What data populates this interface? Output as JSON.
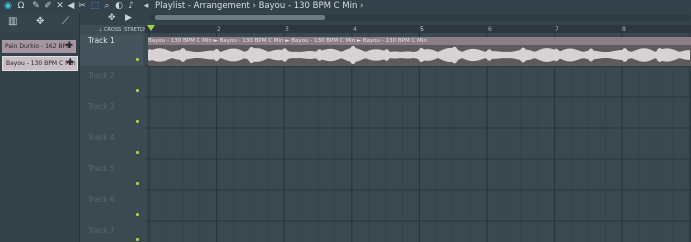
{
  "titlebar": {
    "title": "Playlist - Arrangement › Bayou - 130 BPM C Min ›"
  },
  "patterns": [
    {
      "label": "Pain Durkio - 162 BPM",
      "plus": "✚"
    },
    {
      "label": "Bayou - 130 BPM C Min",
      "plus": "✚"
    }
  ],
  "toolbar": {
    "snap_label": "⊥ CROSS",
    "stretch_label": "STRETCH"
  },
  "ruler": [
    "2",
    "3",
    "4",
    "5",
    "6",
    "7",
    "8"
  ],
  "tracks": [
    {
      "name": "Track 1"
    },
    {
      "name": "Track 2"
    },
    {
      "name": "Track 3"
    },
    {
      "name": "Track 4"
    },
    {
      "name": "Track 5"
    },
    {
      "name": "Track 6"
    },
    {
      "name": "Track 7"
    }
  ],
  "clip": {
    "label": "Bayou - 130 BPM C Min ► Bayou - 130 BPM C Min ► Bayou - 130 BPM C Min ► Bayou - 130 BPM C Min"
  },
  "colors": {
    "accent_green": "#9ed24e",
    "clip_header": "#8a7f86",
    "clip_body": "#5d5a5c",
    "selected_pattern": "#c9bfc6",
    "unselected_pattern": "#a596a0"
  }
}
